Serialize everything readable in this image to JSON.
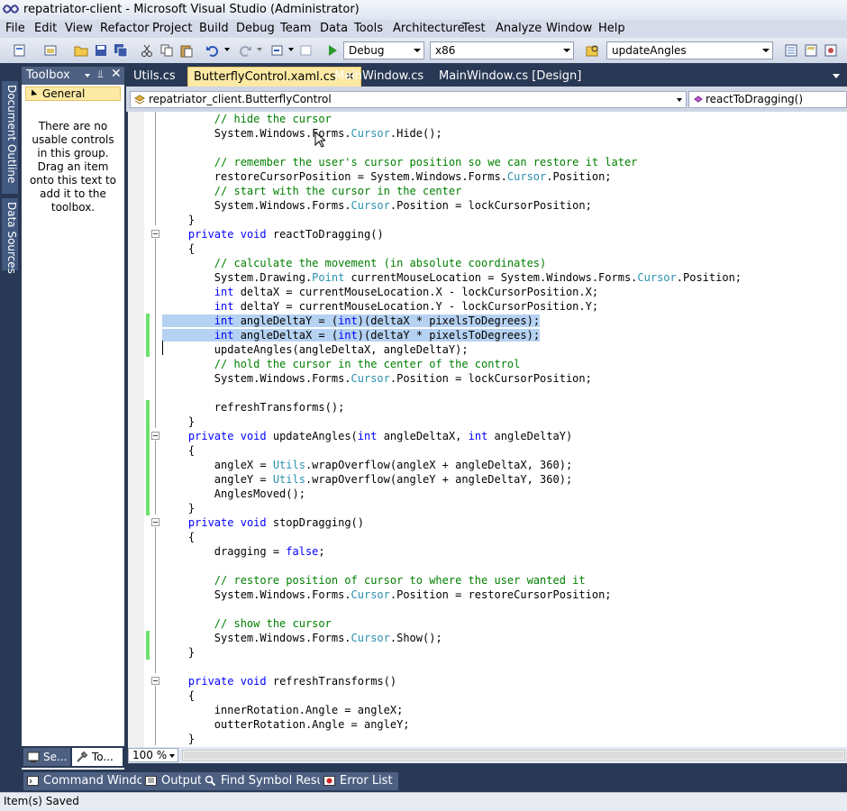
{
  "window": {
    "title": "repatriator-client - Microsoft Visual Studio (Administrator)"
  },
  "menu": {
    "items": [
      "File",
      "Edit",
      "View",
      "Refactor",
      "Project",
      "Build",
      "Debug",
      "Team",
      "Data",
      "Tools",
      "Architecture",
      "Test",
      "Analyze",
      "Window",
      "Help"
    ]
  },
  "toolbar": {
    "configuration": "Debug",
    "platform": "x86",
    "find": "updateAngles"
  },
  "left_strip": {
    "document_outline": "Document Outline",
    "data_sources": "Data Sources"
  },
  "toolbox": {
    "title": "Toolbox",
    "group": "General",
    "empty_message": "There are no usable controls in this group. Drag an item onto this text to add it to the toolbox.",
    "tab_server": "Se...",
    "tab_toolbox": "To..."
  },
  "tabs": [
    "Utils.cs",
    "ButterflyControl.xaml.cs",
    "MainWindow.cs",
    "MainWindow.cs [Design]"
  ],
  "active_tab": "ButterflyControl.xaml.cs",
  "navbar": {
    "type": "repatriator_client.ButterflyControl",
    "member": "reactToDragging()"
  },
  "code": {
    "lines": [
      "        // hide the cursor",
      "        System.Windows.Forms.Cursor.Hide();",
      "",
      "        // remember the user's cursor position so we can restore it later",
      "        restoreCursorPosition = System.Windows.Forms.Cursor.Position;",
      "        // start with the cursor in the center",
      "        System.Windows.Forms.Cursor.Position = lockCursorPosition;",
      "    }",
      "    private void reactToDragging()",
      "    {",
      "        // calculate the movement (in absolute coordinates)",
      "        System.Drawing.Point currentMouseLocation = System.Windows.Forms.Cursor.Position;",
      "        int deltaX = currentMouseLocation.X - lockCursorPosition.X;",
      "        int deltaY = currentMouseLocation.Y - lockCursorPosition.Y;",
      "        int angleDeltaY = (int)(deltaX * pixelsToDegrees);",
      "        int angleDeltaX = (int)(deltaY * pixelsToDegrees);",
      "        updateAngles(angleDeltaX, angleDeltaY);",
      "        // hold the cursor in the center of the control",
      "        System.Windows.Forms.Cursor.Position = lockCursorPosition;",
      "",
      "        refreshTransforms();",
      "    }",
      "    private void updateAngles(int angleDeltaX, int angleDeltaY)",
      "    {",
      "        angleX = Utils.wrapOverflow(angleX + angleDeltaX, 360);",
      "        angleY = Utils.wrapOverflow(angleY + angleDeltaY, 360);",
      "        AnglesMoved();",
      "    }",
      "    private void stopDragging()",
      "    {",
      "        dragging = false;",
      "",
      "        // restore position of cursor to where the user wanted it",
      "        System.Windows.Forms.Cursor.Position = restoreCursorPosition;",
      "",
      "        // show the cursor",
      "        System.Windows.Forms.Cursor.Show();",
      "    }",
      "",
      "    private void refreshTransforms()",
      "    {",
      "        innerRotation.Angle = angleX;",
      "        outterRotation.Angle = angleY;",
      "    }"
    ],
    "selected_lines": [
      14,
      15
    ],
    "changed_lines": [
      14,
      15,
      16,
      20,
      21,
      22,
      23,
      24,
      25,
      26,
      27,
      36,
      37
    ],
    "fold_lines": [
      8,
      22,
      28,
      39
    ]
  },
  "zoom": "100 %",
  "bottom_tabs": [
    "Command Window",
    "Output",
    "Find Symbol Results",
    "Error List"
  ],
  "status": "Item(s) Saved",
  "colors": {
    "keyword": "#0000ff",
    "type": "#2b91af",
    "comment": "#008000",
    "selection": "#b6d2f2",
    "chrome": "#293955"
  }
}
